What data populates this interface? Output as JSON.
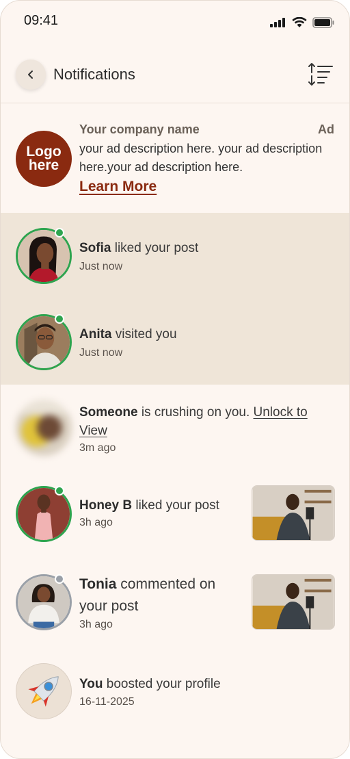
{
  "status_bar": {
    "time": "09:41"
  },
  "header": {
    "title": "Notifications",
    "back_icon": "chevron-left-icon",
    "sort_icon": "sort-icon"
  },
  "ad": {
    "logo_text": "Logo here",
    "company": "Your company name",
    "tag": "Ad",
    "description": "your ad description here. your ad description here.your ad description here.",
    "cta": "Learn More",
    "logo_color": "#8a2a10"
  },
  "notifications": [
    {
      "name": "Sofia",
      "action": "liked your post",
      "time": "Just now",
      "status": "online"
    },
    {
      "name": "Anita",
      "action": "visited you",
      "time": "Just now",
      "status": "online"
    },
    {
      "name": "Someone",
      "action": "is crushing on you.",
      "link": "Unlock to View",
      "time": "3m ago",
      "status": "blurred"
    },
    {
      "name": "Honey B",
      "action": "liked your post",
      "time": "3h ago",
      "status": "online"
    },
    {
      "name": "Tonia",
      "action": "commented on your post",
      "time": "3h ago",
      "status": "offline"
    },
    {
      "name": "You",
      "action": "boosted your profile",
      "time": "16-11-2025",
      "status": "none"
    }
  ],
  "colors": {
    "online": "#2ea44f",
    "offline": "#9aa0a8",
    "highlight": "#efe5d8",
    "background": "#fdf6f1"
  }
}
